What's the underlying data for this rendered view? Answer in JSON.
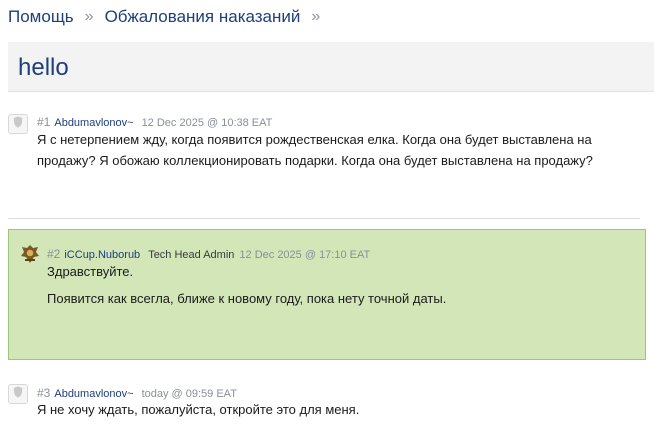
{
  "breadcrumb": {
    "items": [
      "Помощь",
      "Обжалования наказаний"
    ],
    "separator": "»"
  },
  "topic": {
    "title": "hello"
  },
  "posts": [
    {
      "number": "#1",
      "user": "Abdumavlonov~",
      "role": "",
      "time": "12 Dec 2025 @ 10:38 EAT",
      "body": [
        "Я с нетерпением жду, когда появится рождественская елка. Когда она будет выставлена на продажу? Я обожаю коллекционировать подарки. Когда она будет выставлена на продажу?"
      ]
    },
    {
      "number": "#2",
      "user": "iCCup.Nuborub",
      "role": "Tech Head Admin",
      "time": "12 Dec 2025 @ 17:10 EAT",
      "body": [
        "Здравствуйте.",
        "Появится как всегла, ближе к новому году, пока нету точной даты."
      ]
    },
    {
      "number": "#3",
      "user": "Abdumavlonov~",
      "role": "",
      "time": "today @ 09:59 EAT",
      "body": [
        "Я не хочу ждать, пожалуйста, откройте это для меня."
      ]
    }
  ],
  "colors": {
    "link": "#1d3f7a",
    "highlight_bg": "#d2e6b8",
    "highlight_border": "#9fc57a",
    "muted": "#8a8f98"
  },
  "icons": {
    "default_avatar": "shield-icon",
    "admin_avatar": "crest-icon"
  }
}
